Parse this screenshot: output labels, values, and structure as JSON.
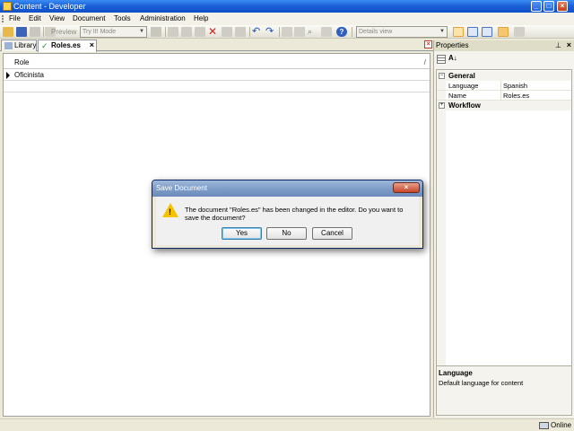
{
  "window": {
    "title": "Content - Developer"
  },
  "menu": [
    "File",
    "Edit",
    "View",
    "Document",
    "Tools",
    "Administration",
    "Help"
  ],
  "toolbar": {
    "preview_label": "Preview",
    "mode_combo": "Try It! Mode",
    "view_combo": "Details view"
  },
  "tabs": [
    {
      "label": "Library",
      "active": false
    },
    {
      "label": "Roles.es",
      "active": true
    }
  ],
  "editor": {
    "column_header": "Role",
    "rows": [
      "Oficinista"
    ]
  },
  "properties": {
    "title": "Properties",
    "categories": [
      {
        "name": "General",
        "expanded": true
      },
      {
        "name": "Workflow",
        "expanded": false
      }
    ],
    "items": [
      {
        "key": "Language",
        "value": "Spanish"
      },
      {
        "key": "Name",
        "value": "Roles.es"
      }
    ],
    "description_title": "Language",
    "description_text": "Default language for content"
  },
  "status": {
    "text": "Online"
  },
  "dialog": {
    "title": "Save Document",
    "message": "The document \"Roles.es\" has been changed in the editor. Do you want to save the document?",
    "yes_label": "Yes",
    "no_label": "No",
    "cancel_label": "Cancel"
  },
  "colors": {
    "title_blue": "#1b5fd6",
    "dialog_title": "#7d9bc7",
    "warning": "#f5c400"
  }
}
